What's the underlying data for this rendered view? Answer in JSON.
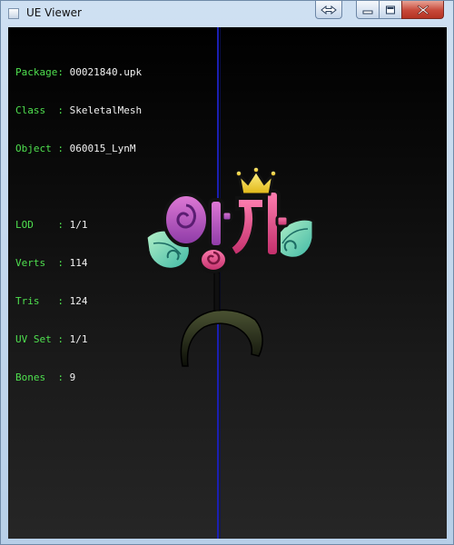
{
  "window": {
    "title": "UE Viewer"
  },
  "titlebar_buttons": {
    "swap": "swap-arrows-icon",
    "minimize": "minimize-icon",
    "maximize": "maximize-icon",
    "close": "close-icon"
  },
  "info": {
    "package_label": "Package:",
    "package_value": "00021840.upk",
    "class_label": "Class  :",
    "class_value": "SkeletalMesh",
    "object_label": "Object :",
    "object_value": "060015_LynM",
    "lod_label": "LOD    :",
    "lod_value": "1/1",
    "verts_label": "Verts  :",
    "verts_value": "114",
    "tris_label": "Tris   :",
    "tris_value": "124",
    "uvset_label": "UV Set :",
    "uvset_value": "1/1",
    "bones_label": "Bones  :",
    "bones_value": "9"
  },
  "colors": {
    "label_green": "#4fe04f",
    "value_white": "#f2f2f2",
    "axis_blue": "#1a1fb3"
  }
}
